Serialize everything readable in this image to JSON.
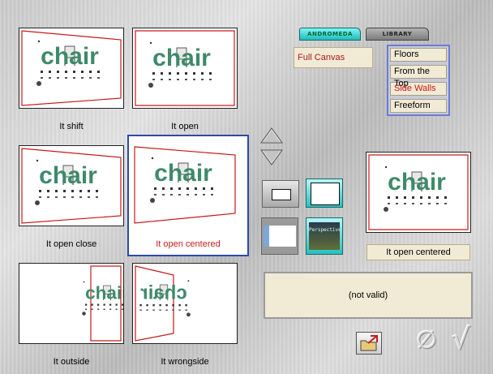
{
  "thumbnails": [
    {
      "id": "shift",
      "label": "It shift",
      "selected": false
    },
    {
      "id": "open",
      "label": "It open",
      "selected": false
    },
    {
      "id": "open-close",
      "label": "It open close",
      "selected": false
    },
    {
      "id": "open-centered",
      "label": "It open centered",
      "selected": true
    },
    {
      "id": "outside",
      "label": "It outside",
      "selected": false
    },
    {
      "id": "wrongside",
      "label": "It wrongside",
      "selected": false
    }
  ],
  "artwork": {
    "title": "chair",
    "mirrored_title": "chair"
  },
  "tabs": [
    {
      "label": "ANDROMEDA",
      "active": true
    },
    {
      "label": "LIBRARY",
      "active": false
    }
  ],
  "mode": {
    "value": "Full Canvas"
  },
  "menu": {
    "items": [
      {
        "label": "Floors",
        "active": false
      },
      {
        "label": "From the Top",
        "active": false
      },
      {
        "label": "Side Walls",
        "active": true
      },
      {
        "label": "Freeform",
        "active": false
      }
    ]
  },
  "tool_buttons": {
    "perspective_label": "Perspective"
  },
  "preview": {
    "label": "It open centered"
  },
  "status": {
    "text": "(not valid)"
  },
  "actions": {
    "cancel_glyph": "∅",
    "confirm_glyph": "√"
  },
  "colors": {
    "accent": "#2b4aa8",
    "selected_text": "#c81a1a",
    "panel": "#f1ead5",
    "art_green": "#3e8a6a"
  }
}
